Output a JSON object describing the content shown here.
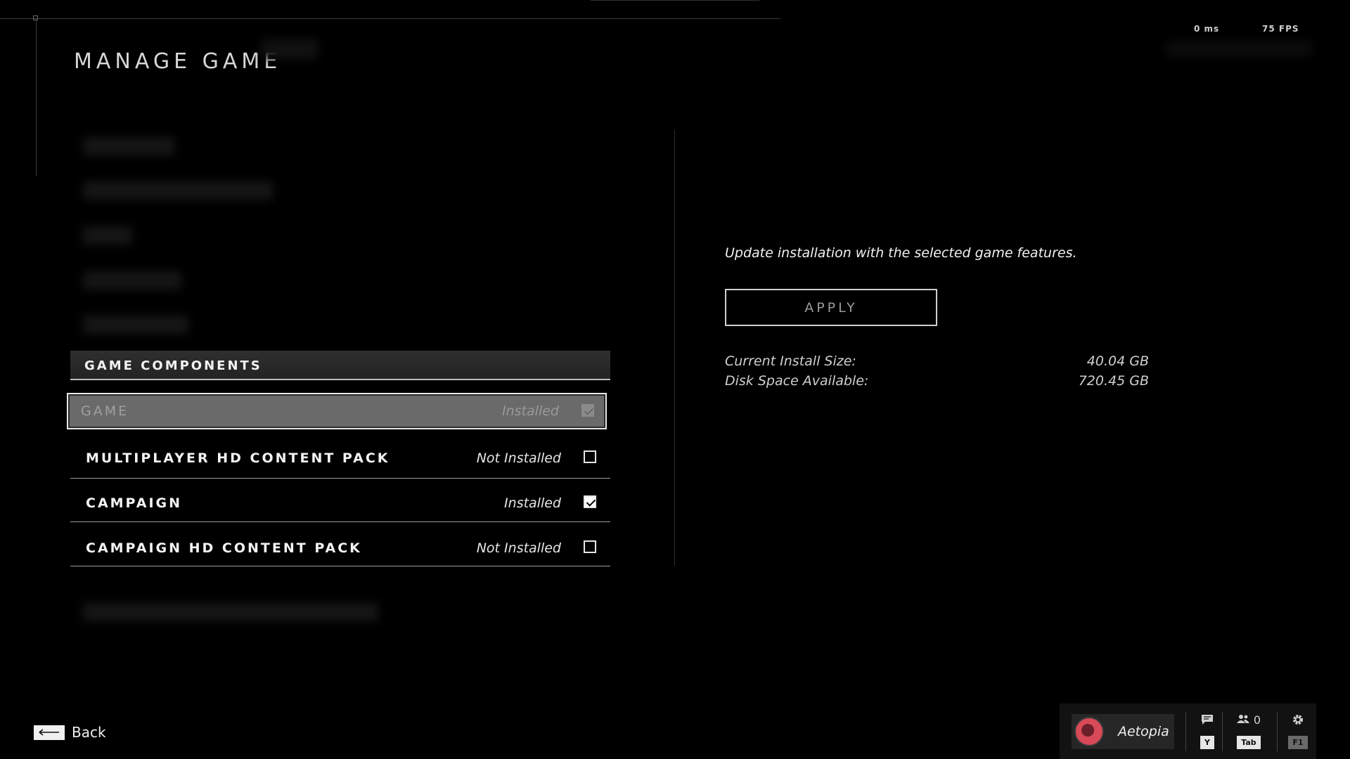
{
  "page": {
    "title": "MANAGE GAME"
  },
  "perf": {
    "latency": "0 ms",
    "fps": "75 FPS"
  },
  "components": {
    "header": "GAME COMPONENTS",
    "items": [
      {
        "name": "GAME",
        "status": "Installed",
        "checked": true,
        "focused": true,
        "disabled": true
      },
      {
        "name": "MULTIPLAYER HD CONTENT PACK",
        "status": "Not Installed",
        "checked": false
      },
      {
        "name": "CAMPAIGN",
        "status": "Installed",
        "checked": true
      },
      {
        "name": "CAMPAIGN HD CONTENT PACK",
        "status": "Not Installed",
        "checked": false
      }
    ]
  },
  "details": {
    "description": "Update installation with the selected game features.",
    "apply_label": "APPLY",
    "install_size_label": "Current Install Size:",
    "install_size_value": "40.04 GB",
    "disk_space_label": "Disk Space Available:",
    "disk_space_value": "720.45 GB"
  },
  "footer": {
    "back_label": "Back",
    "profile_name": "Aetopia",
    "chat_key": "Y",
    "friends_count": "0",
    "friends_key": "Tab",
    "settings_key": "F1"
  },
  "icons": {
    "back": "arrow-left-icon",
    "chat": "chat-icon",
    "friends": "people-icon",
    "settings": "gear-icon"
  }
}
